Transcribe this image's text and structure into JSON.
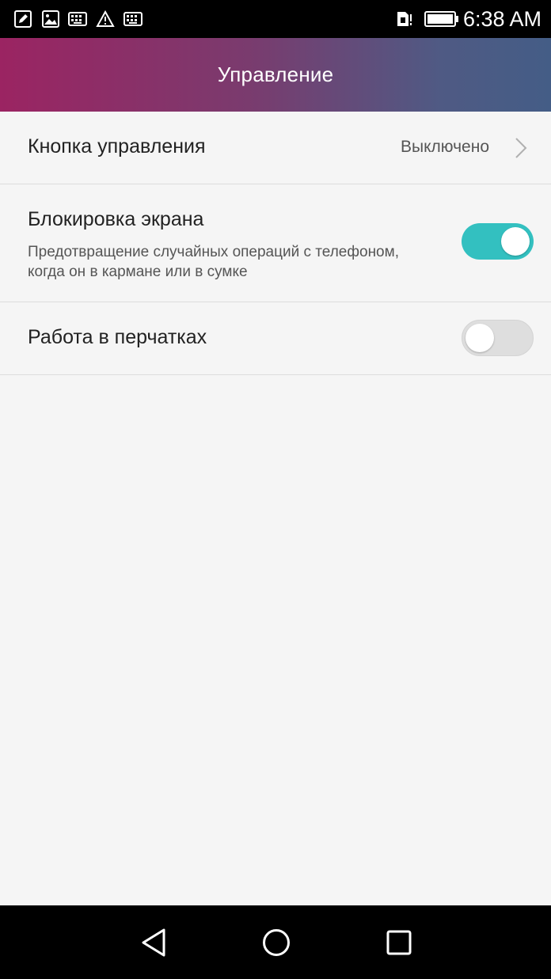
{
  "status_bar": {
    "time": "6:38 AM",
    "icons": [
      "edit-icon",
      "image-icon",
      "keyboard-icon",
      "warning-icon",
      "keyboard-icon",
      "sim-alert-icon",
      "battery-icon"
    ]
  },
  "header": {
    "title": "Управление"
  },
  "settings": {
    "control_button": {
      "title": "Кнопка управления",
      "value": "Выключено"
    },
    "screen_lock": {
      "title": "Блокировка экрана",
      "subtitle": "Предотвращение случайных операций с телефоном, когда он в кармане или в сумке",
      "enabled": true
    },
    "glove_mode": {
      "title": "Работа в перчатках",
      "enabled": false
    }
  },
  "colors": {
    "accent": "#33c0c0",
    "header_start": "#9b2462",
    "header_end": "#445d86"
  },
  "nav_bar": {
    "buttons": [
      "back-icon",
      "home-icon",
      "recents-icon"
    ]
  }
}
